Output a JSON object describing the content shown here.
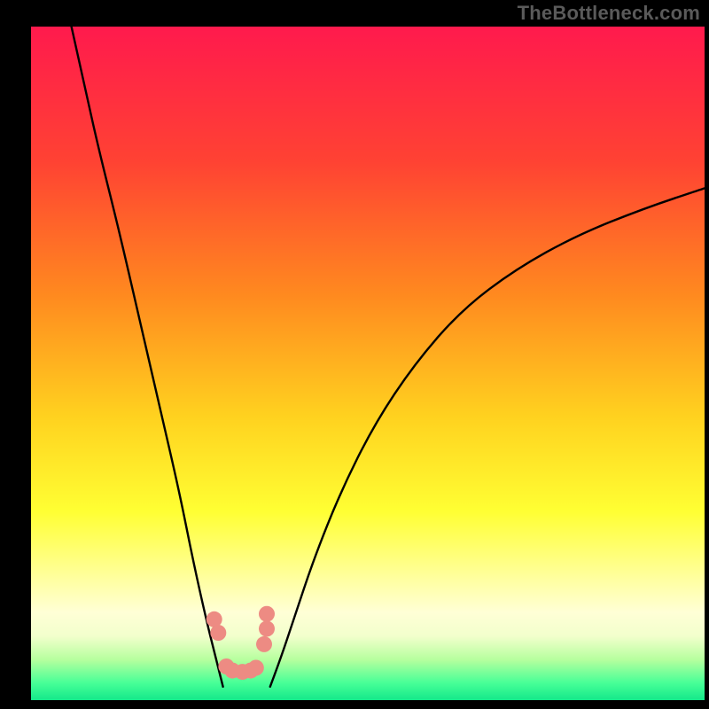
{
  "watermark": "TheBottleneck.com",
  "chart_data": {
    "type": "line",
    "title": "",
    "xlabel": "",
    "ylabel": "",
    "xlim": [
      0,
      100
    ],
    "ylim": [
      0,
      100
    ],
    "grid": false,
    "gradient_stops": [
      {
        "offset": 0.0,
        "color": "#ff1a4d"
      },
      {
        "offset": 0.2,
        "color": "#ff4233"
      },
      {
        "offset": 0.4,
        "color": "#ff8a1f"
      },
      {
        "offset": 0.58,
        "color": "#ffd21f"
      },
      {
        "offset": 0.72,
        "color": "#ffff33"
      },
      {
        "offset": 0.8,
        "color": "#ffff8a"
      },
      {
        "offset": 0.87,
        "color": "#ffffd6"
      },
      {
        "offset": 0.905,
        "color": "#f2ffcc"
      },
      {
        "offset": 0.94,
        "color": "#b6ff9e"
      },
      {
        "offset": 0.975,
        "color": "#46ff97"
      },
      {
        "offset": 1.0,
        "color": "#14e88a"
      }
    ],
    "series": [
      {
        "name": "curve-left",
        "type": "line",
        "x": [
          6,
          8,
          10,
          13,
          16,
          19,
          22,
          24,
          26,
          27.5,
          28.5
        ],
        "y": [
          100,
          91,
          82,
          70,
          57,
          44,
          31,
          21,
          12,
          6,
          2
        ]
      },
      {
        "name": "curve-right",
        "type": "line",
        "x": [
          35.5,
          37,
          39,
          42,
          46,
          51,
          57,
          64,
          72,
          81,
          91,
          100
        ],
        "y": [
          2,
          6,
          12,
          21,
          31,
          41,
          50,
          58,
          64,
          69,
          73,
          76
        ]
      },
      {
        "name": "markers",
        "type": "scatter",
        "color": "#ed8b83",
        "x": [
          27.2,
          27.8,
          29.0,
          29.9,
          31.4,
          32.6,
          33.4,
          34.6,
          35.0,
          35.0
        ],
        "y": [
          12.0,
          10.0,
          5.0,
          4.4,
          4.2,
          4.4,
          4.8,
          8.3,
          10.6,
          12.8
        ]
      }
    ]
  }
}
